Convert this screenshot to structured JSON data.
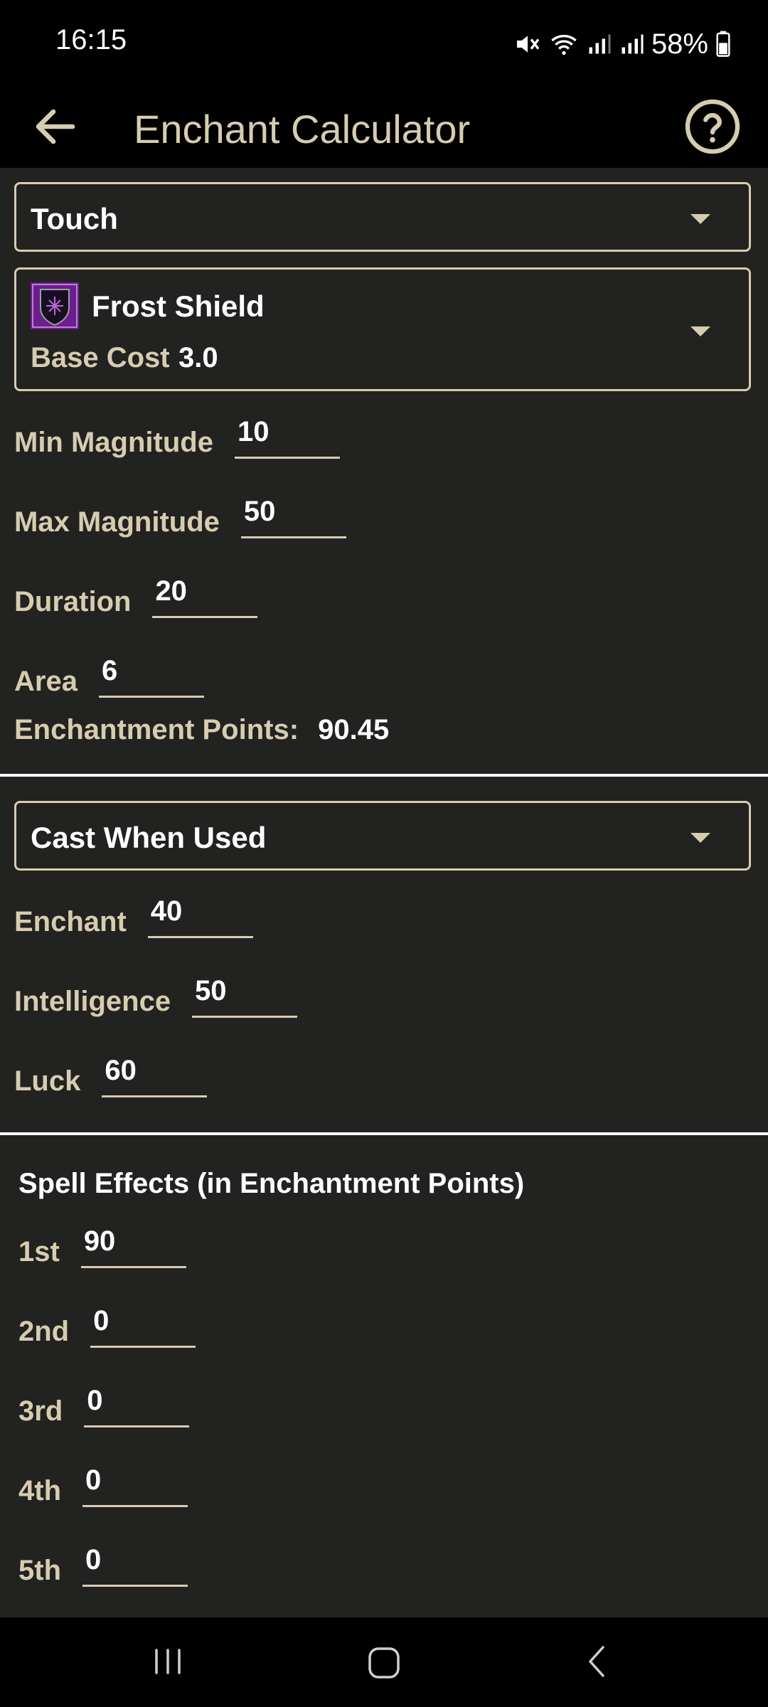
{
  "status": {
    "time": "16:15",
    "battery": "58%"
  },
  "appbar": {
    "title": "Enchant Calculator",
    "back_icon": "arrow-left-icon",
    "help_icon": "question-circle-icon"
  },
  "range_dropdown": {
    "selected": "Touch"
  },
  "effect_dropdown": {
    "selected": "Frost Shield",
    "base_cost_label": "Base Cost",
    "base_cost": "3.0",
    "icon": "frost-shield-icon"
  },
  "magnitude": {
    "min_label": "Min Magnitude",
    "min": "10",
    "max_label": "Max Magnitude",
    "max": "50",
    "duration_label": "Duration",
    "duration": "20",
    "area_label": "Area",
    "area": "6"
  },
  "result": {
    "label": "Enchantment Points:",
    "value": "90.45"
  },
  "cast_dropdown": {
    "selected": "Cast When Used"
  },
  "skills": {
    "enchant_label": "Enchant",
    "enchant": "40",
    "intelligence_label": "Intelligence",
    "intelligence": "50",
    "luck_label": "Luck",
    "luck": "60"
  },
  "spell_effects": {
    "title": "Spell Effects (in Enchantment Points)",
    "items": [
      {
        "label": "1st",
        "value": "90"
      },
      {
        "label": "2nd",
        "value": "0"
      },
      {
        "label": "3rd",
        "value": "0"
      },
      {
        "label": "4th",
        "value": "0"
      },
      {
        "label": "5th",
        "value": "0"
      }
    ]
  },
  "colors": {
    "background": "#222220",
    "accent": "#d6ccb0",
    "bar": "#000000"
  }
}
